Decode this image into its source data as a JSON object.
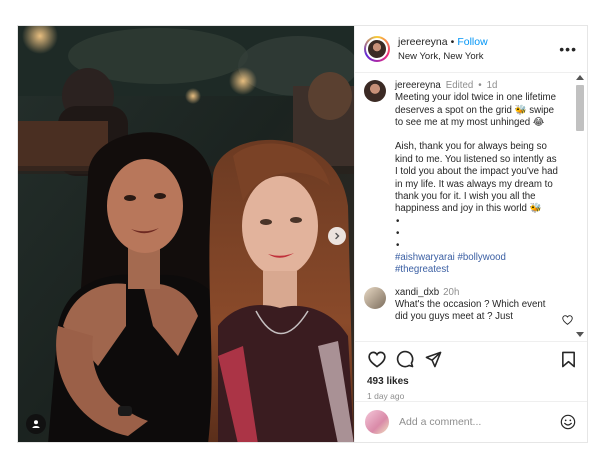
{
  "header": {
    "username": "jereereyna",
    "separator": "•",
    "follow_label": "Follow",
    "location": "New York, New York",
    "more_label": "•••"
  },
  "caption": {
    "username": "jereereyna",
    "edited_label": "Edited",
    "separator": "•",
    "time": "1d",
    "lines_1": [
      "Meeting your idol twice in one lifetime",
      "deserves a spot on the grid 🐝 swipe",
      "to see me at my most unhinged 😂"
    ],
    "lines_2": [
      "Aish, thank you for always being so",
      "kind to me. You listened so intently as",
      "I told you about the impact you've had",
      "in my life. It was always my dream to",
      "thank you for it. I wish you all the",
      "happiness and joy in this world 🐝"
    ],
    "bullets": [
      "•",
      "•",
      "•"
    ],
    "hashtags_line_1": "#aishwaryarai #bollywood",
    "hashtags_line_2": "#thegreatest"
  },
  "comment": {
    "username": "xandi_dxb",
    "time": "20h",
    "lines": [
      "What's the occasion ? Which event",
      "did you guys meet at ? Just"
    ]
  },
  "actions": {
    "likes": "493 likes",
    "date": "1 day ago"
  },
  "add_comment": {
    "placeholder": "Add a comment..."
  },
  "icons": {
    "like": "heart-icon",
    "comment": "comment-icon",
    "share": "share-icon",
    "save": "bookmark-icon",
    "emoji": "emoji-icon",
    "next": "chevron-right-icon",
    "tag": "user-tag-icon",
    "more": "more-options-icon"
  },
  "colors": {
    "follow_blue": "#0095f6",
    "hashtag_blue": "#3b5fa3",
    "muted_gray": "#8e8e8e",
    "text": "#262626"
  }
}
